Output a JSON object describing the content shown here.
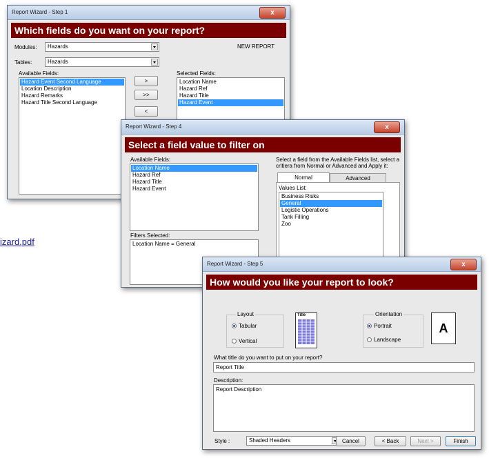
{
  "link_text": "izard.pdf",
  "step1": {
    "title": "Report Wizard - Step 1",
    "close": "x",
    "heading": "Which fields do you want on your report?",
    "modules_label": "Modules:",
    "modules_value": "Hazards",
    "tables_label": "Tables:",
    "tables_value": "Hazards",
    "new_report": "NEW REPORT",
    "available_label": "Available Fields:",
    "available": [
      "Hazard Event Second Language",
      "Location Description",
      "Hazard Remarks",
      "Hazard Title Second Language"
    ],
    "selected_label": "Selected Fields:",
    "selected": [
      "Location Name",
      "Hazard Ref",
      "Hazard Title",
      "Hazard Event"
    ],
    "btn_add": ">",
    "btn_add_all": ">>",
    "btn_remove": "<"
  },
  "step4": {
    "title": "Report Wizard - Step 4",
    "close": "x",
    "heading": "Select a field value to filter on",
    "available_label": "Available Fields:",
    "available": [
      "Location Name",
      "Hazard Ref",
      "Hazard Title",
      "Hazard Event"
    ],
    "instructions": "Select a field from the Available Fields list, select a critiera from Normal or Advanced and Apply it:",
    "tab_normal": "Normal",
    "tab_advanced": "Advanced",
    "values_label": "Values List:",
    "values": [
      "Business Risks",
      "General",
      "Logistic Operations",
      "Tank Filling",
      "Zoo"
    ],
    "filters_label": "Filters Selected:",
    "filters_value": "Location Name = General"
  },
  "step5": {
    "title": "Report Wizard - Step 5",
    "close": "x",
    "heading": "How would you like your report to look?",
    "layout_label": "Layout",
    "layout_tabular": "Tabular",
    "layout_vertical": "Vertical",
    "preview_title": "Title",
    "orientation_label": "Orientation",
    "portrait": "Portrait",
    "landscape": "Landscape",
    "orientation_letter": "A",
    "title_question": "What title do you want to put on your report?",
    "title_value": "Report Title",
    "description_label": "Description:",
    "description_value": "Report Description",
    "style_label": "Style :",
    "style_value": "Shaded Headers",
    "cancel": "Cancel",
    "back": "< Back",
    "next": "Next >",
    "finish": "Finish"
  }
}
